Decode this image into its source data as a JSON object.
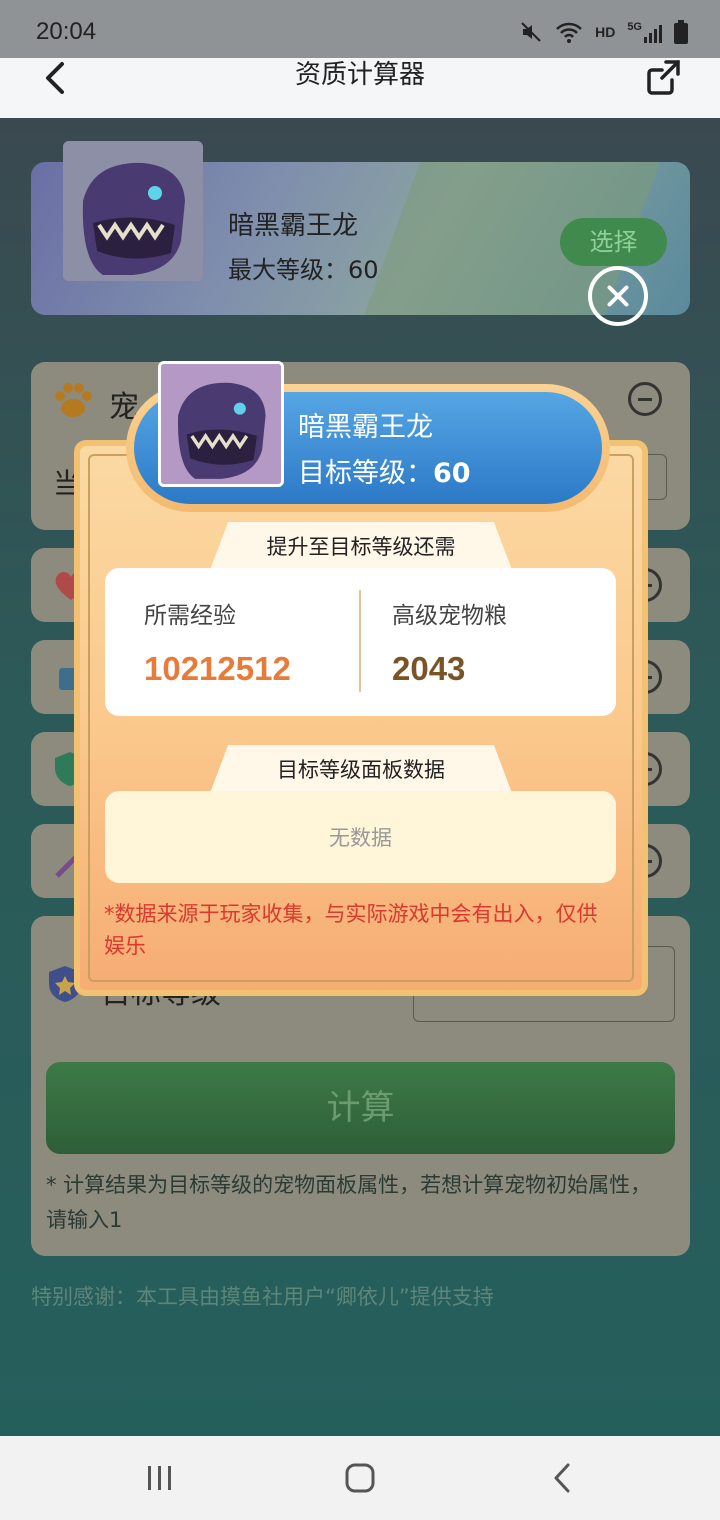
{
  "status_bar": {
    "time": "20:04",
    "network": "HD",
    "signal": "5G"
  },
  "topbar": {
    "title": "资质计算器"
  },
  "pet": {
    "name": "暗黑霸王龙",
    "max_level": "最大等级：60",
    "select_label": "选择"
  },
  "background": {
    "pet_type_label": "宠",
    "current_label": "当",
    "target_level_label": "目标等级",
    "calculate_label": "计算",
    "note": "* 计算结果为目标等级的宠物面板属性，若想计算宠物初始属性，请输入1",
    "thanks": "特别感谢：本工具由摸鱼社用户“卿依儿”提供支持"
  },
  "modal": {
    "pet_name": "暗黑霸王龙",
    "target_level_prefix": "目标等级：",
    "target_level_value": "60",
    "requirement_title": "提升至目标等级还需",
    "exp_label": "所需经验",
    "exp_value": "10212512",
    "food_label": "高级宠物粮",
    "food_value": "2043",
    "panel_title": "目标等级面板数据",
    "no_data": "无数据",
    "disclaimer": "*数据来源于玩家收集，与实际游戏中会有出入，仅供娱乐"
  },
  "colors": {
    "accent_orange": "#e77b3a",
    "food_brown": "#7a5427",
    "banner_blue": "#2c79c7",
    "disclaimer_red": "#d9392e"
  }
}
